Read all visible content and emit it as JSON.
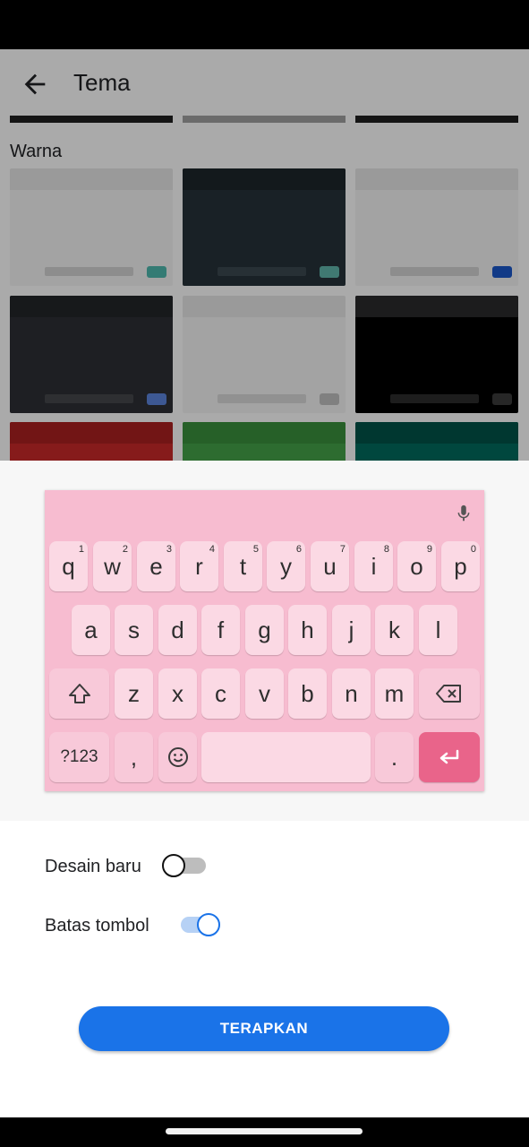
{
  "app_bar": {
    "title": "Tema"
  },
  "section": {
    "title": "Warna"
  },
  "colors": {
    "accent": "#1a73e8",
    "keyboard_bg": "#f7bcd0",
    "key_bg": "#fbd9e4",
    "enter_key": "#e9648a"
  },
  "keyboard": {
    "row1": [
      {
        "label": "q",
        "hint": "1"
      },
      {
        "label": "w",
        "hint": "2"
      },
      {
        "label": "e",
        "hint": "3"
      },
      {
        "label": "r",
        "hint": "4"
      },
      {
        "label": "t",
        "hint": "5"
      },
      {
        "label": "y",
        "hint": "6"
      },
      {
        "label": "u",
        "hint": "7"
      },
      {
        "label": "i",
        "hint": "8"
      },
      {
        "label": "o",
        "hint": "9"
      },
      {
        "label": "p",
        "hint": "0"
      }
    ],
    "row2": [
      "a",
      "s",
      "d",
      "f",
      "g",
      "h",
      "j",
      "k",
      "l"
    ],
    "row3": [
      "z",
      "x",
      "c",
      "v",
      "b",
      "n",
      "m"
    ],
    "symbols_label": "?123",
    "comma_label": ",",
    "period_label": "."
  },
  "settings": {
    "new_design": {
      "label": "Desain baru",
      "enabled": false
    },
    "key_border": {
      "label": "Batas tombol",
      "enabled": true
    }
  },
  "apply_button": {
    "label": "TERAPKAN"
  }
}
